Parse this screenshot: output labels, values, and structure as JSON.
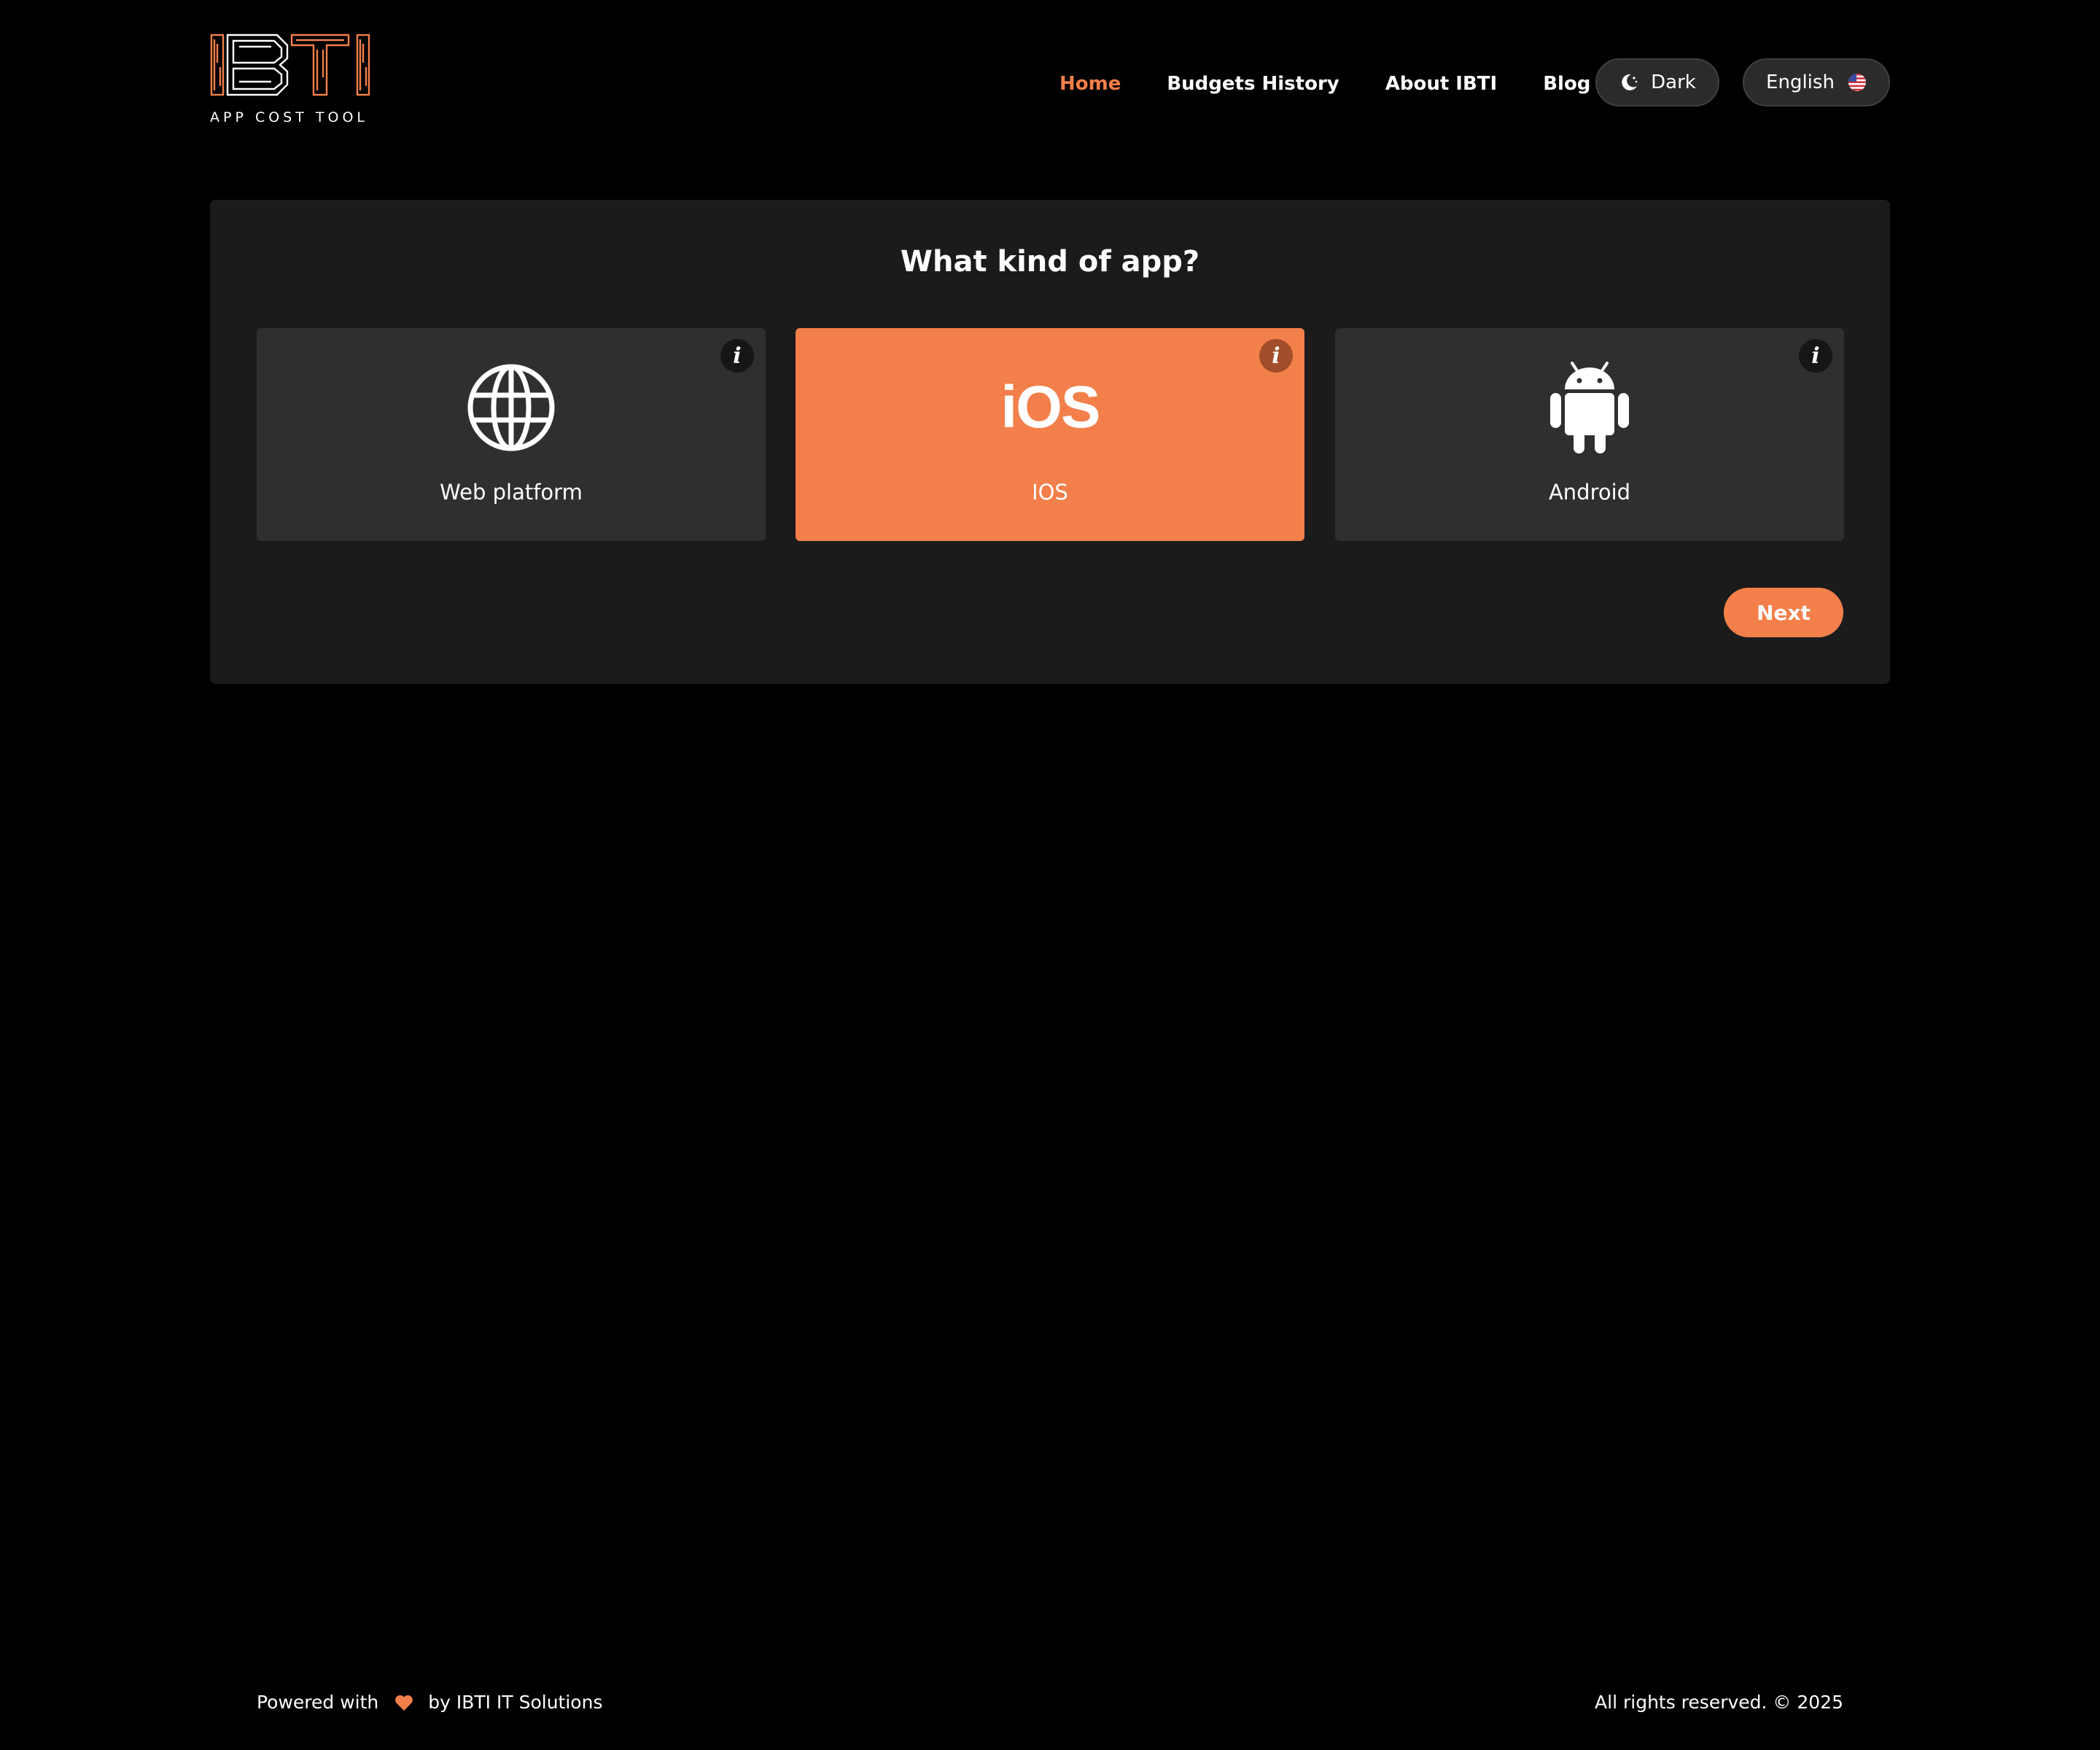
{
  "brand": {
    "logo_letters": "IBTI",
    "subtitle": "APP COST TOOL"
  },
  "nav": {
    "items": [
      {
        "label": "Home",
        "active": true
      },
      {
        "label": "Budgets History",
        "active": false
      },
      {
        "label": "About IBTI",
        "active": false
      },
      {
        "label": "Blog",
        "active": false
      }
    ]
  },
  "theme_toggle": {
    "label": "Dark",
    "icon": "moon-icon"
  },
  "language_select": {
    "label": "English",
    "icon": "us-flag-icon"
  },
  "main": {
    "title": "What kind of app?",
    "options": [
      {
        "label": "Web platform",
        "icon": "globe-icon",
        "selected": false,
        "info_glyph": "i"
      },
      {
        "label": "IOS",
        "icon_text": "iOS",
        "selected": true,
        "info_glyph": "i"
      },
      {
        "label": "Android",
        "icon": "android-icon",
        "selected": false,
        "info_glyph": "i"
      }
    ],
    "next_label": "Next"
  },
  "footer": {
    "powered_prefix": "Powered with",
    "powered_suffix": "by IBTI IT Solutions",
    "rights": "All rights reserved. © 2025"
  },
  "colors": {
    "accent": "#f37f4a",
    "background": "#000000",
    "panel": "#1b1b1b",
    "card": "#2f2f2f"
  }
}
